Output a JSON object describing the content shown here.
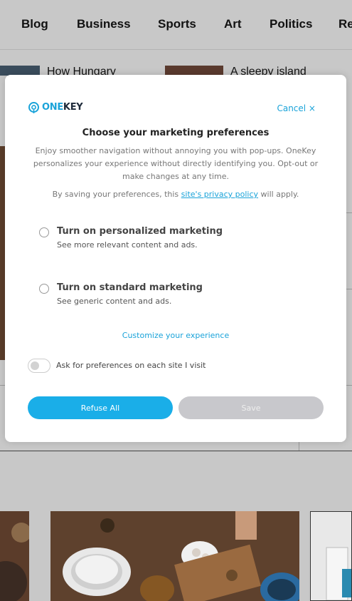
{
  "nav": {
    "items": [
      "Blog",
      "Business",
      "Sports",
      "Art",
      "Politics",
      "Re"
    ]
  },
  "background": {
    "headlines": [
      "How Hungary",
      "A sleepy island"
    ]
  },
  "modal": {
    "logo": {
      "one": "ONE",
      "key": "KEY"
    },
    "cancel_label": "Cancel ×",
    "title": "Choose your marketing preferences",
    "description": "Enjoy smoother navigation without annoying you with pop-ups. OneKey personalizes your experience without directly identifying you. Opt-out or make changes at any time.",
    "privacy": {
      "before": "By saving your preferences, this ",
      "link": "site's privacy policy",
      "after": " will apply."
    },
    "options": [
      {
        "title": "Turn on personalized marketing",
        "subtitle": "See more relevant content and ads."
      },
      {
        "title": "Turn on standard marketing",
        "subtitle": "See generic content and ads."
      }
    ],
    "customize_label": "Customize your experience",
    "toggle_label": "Ask for preferences on each site I visit",
    "refuse_label": "Refuse All",
    "save_label": "Save"
  },
  "colors": {
    "accent": "#1aaee8",
    "save_disabled": "#c8c8cc",
    "overlay": "#c8c8c8"
  },
  "icons": [
    "onekey-logo-icon",
    "close-icon"
  ]
}
